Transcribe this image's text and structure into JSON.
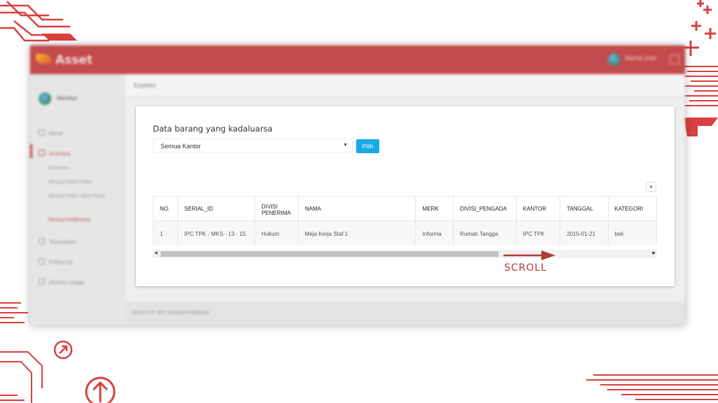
{
  "app": {
    "logo_text": "Asset",
    "user_name": "Nama User",
    "sidebar": {
      "profile_name": "Member",
      "items": [
        {
          "label": "Home"
        },
        {
          "label": "Inventory"
        },
        {
          "label": "Transaction"
        },
        {
          "label": "Follow Up"
        },
        {
          "label": "Division Usage"
        }
      ],
      "inventory_sub": [
        {
          "label": "Overview"
        },
        {
          "label": "Barang Habis Pakai"
        },
        {
          "label": "Barang Tidak Habis Pakai"
        },
        {
          "label": "Barang Kadaluarsa"
        }
      ]
    },
    "header_title": "Expired",
    "footer_text": "2015 © PT IPC Terminal Petikemas"
  },
  "card": {
    "title": "Data barang yang kadaluarsa",
    "select_value": "Semua Kantor",
    "pilih_label": "Pilih",
    "scroll_top_glyph": "▲",
    "table": {
      "headers": [
        "NO.",
        "SERIAL_ID",
        "DIVISI PENERIMA",
        "NAMA",
        "MERK",
        "DIVISI_PENGADA",
        "KANTOR",
        "TANGGAL",
        "KATEGORI"
      ],
      "rows": [
        [
          "1",
          "IPC TPK - MKS - 13 - 15",
          "Hukum",
          "Meja Kerja Staf 1",
          "Informa",
          "Rumah Tangga",
          "IPC TPK",
          "2015-01-21",
          "beli"
        ]
      ]
    }
  },
  "annotation": {
    "scroll_label": "SCROLL",
    "color": "#b33a3c"
  },
  "colors": {
    "brand": "#c44b4d",
    "button": "#19a9e5",
    "accent": "#d9403f"
  }
}
